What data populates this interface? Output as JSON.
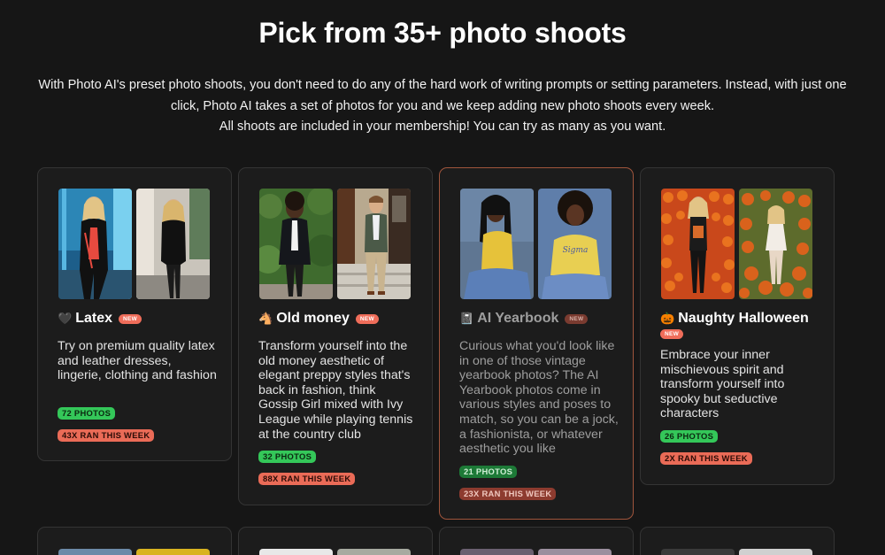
{
  "header": {
    "title": "Pick from 35+ photo shoots",
    "intro_line1": "With Photo AI's preset photo shoots, you don't need to do any of the hard work of writing prompts or setting parameters. Instead, with just one",
    "intro_line2": "click, Photo AI takes a set of photos for you and we keep adding new photo shoots every week.",
    "intro_line3": "All shoots are included in your membership! You can try as many as you want."
  },
  "cards": [
    {
      "emoji": "🖤",
      "title": "Latex",
      "badge": "NEW",
      "description": "Try on premium quality latex and leather dresses, lingerie, clothing and fashion",
      "photos": "72 PHOTOS",
      "ran": "43X RAN THIS WEEK"
    },
    {
      "emoji": "🐴",
      "title": "Old money",
      "badge": "NEW",
      "description": "Transform yourself into the old money aesthetic of elegant preppy styles that's back in fashion, think Gossip Girl mixed with Ivy League while playing tennis at the country club",
      "photos": "32 PHOTOS",
      "ran": "88X RAN THIS WEEK"
    },
    {
      "emoji": "📓",
      "title": "AI Yearbook",
      "badge": "NEW",
      "description": "Curious what you'd look like in one of those vintage yearbook photos? The AI Yearbook photos come in various styles and poses to match, so you can be a jock, a fashionista, or whatever aesthetic you like",
      "photos": "21 PHOTOS",
      "ran": "23X RAN THIS WEEK",
      "thumb_text": "Sigma"
    },
    {
      "emoji": "🎃",
      "title": "Naughty Halloween",
      "badge": "NEW",
      "description": "Embrace your inner mischievous spirit and transform yourself into spooky but seductive characters",
      "photos": "26 PHOTOS",
      "ran": "2X RAN THIS WEEK"
    }
  ],
  "colors": {
    "background": "#161616",
    "card_bg": "#1c1c1c",
    "card_border": "#343434",
    "highlight_border": "#a0553c",
    "photos_pill": "#34c759",
    "ran_pill": "#ea6b57",
    "new_badge": "#ef6d5a"
  }
}
